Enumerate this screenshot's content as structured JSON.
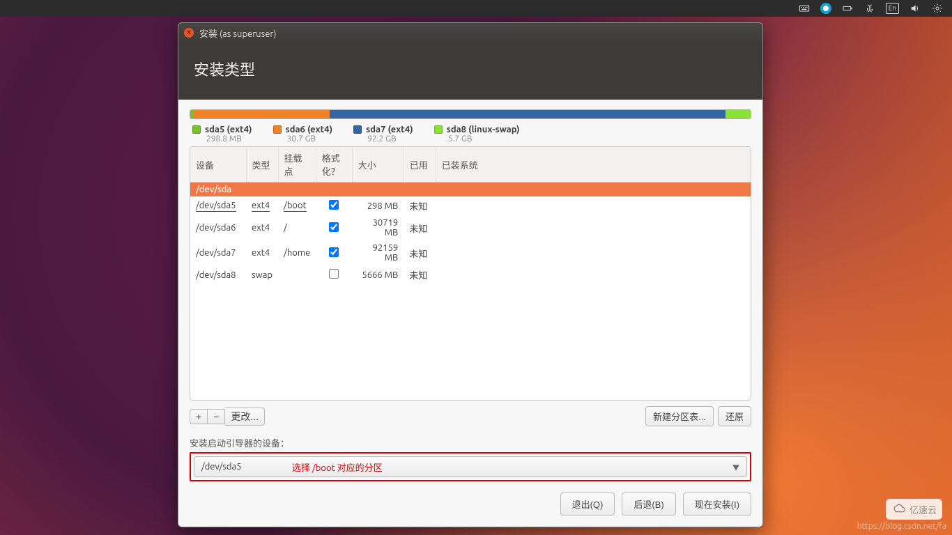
{
  "panel": {
    "lang": "En"
  },
  "window": {
    "title": "安装 (as superuser)",
    "heading": "安装类型"
  },
  "legend": [
    {
      "swatch": "#75c22b",
      "label": "sda5 (ext4)",
      "size": "298.8 MB"
    },
    {
      "swatch": "#f08327",
      "label": "sda6 (ext4)",
      "size": "30.7 GB"
    },
    {
      "swatch": "#3465a4",
      "label": "sda7 (ext4)",
      "size": "92.2 GB"
    },
    {
      "swatch": "#8ae234",
      "label": "sda8 (linux-swap)",
      "size": "5.7 GB"
    }
  ],
  "columns": {
    "device": "设备",
    "type": "类型",
    "mount": "挂载点",
    "format": "格式化？",
    "size": "大小",
    "used": "已用",
    "system": "已装系统"
  },
  "group": "/dev/sda",
  "rows": [
    {
      "device": "/dev/sda5",
      "type": "ext4",
      "mount": "/boot",
      "fmt": true,
      "size": "298 MB",
      "used": "未知",
      "hl": true
    },
    {
      "device": "/dev/sda6",
      "type": "ext4",
      "mount": "/",
      "fmt": true,
      "size": "30719 MB",
      "used": "未知"
    },
    {
      "device": "/dev/sda7",
      "type": "ext4",
      "mount": "/home",
      "fmt": true,
      "size": "92159 MB",
      "used": "未知"
    },
    {
      "device": "/dev/sda8",
      "type": "swap",
      "mount": "",
      "fmt": false,
      "size": "5666 MB",
      "used": "未知"
    }
  ],
  "toolbar": {
    "add": "+",
    "remove": "−",
    "change": "更改...",
    "newtable": "新建分区表...",
    "revert": "还原"
  },
  "bootloader": {
    "label": "安装启动引导器的设备：",
    "value": "/dev/sda5",
    "annotation": "选择 /boot 对应的分区"
  },
  "footer": {
    "quit": "退出(Q)",
    "back": "后退(B)",
    "install": "现在安装(I)"
  },
  "watermark": "https://blog.csdn.net/fa",
  "logo": "亿速云"
}
